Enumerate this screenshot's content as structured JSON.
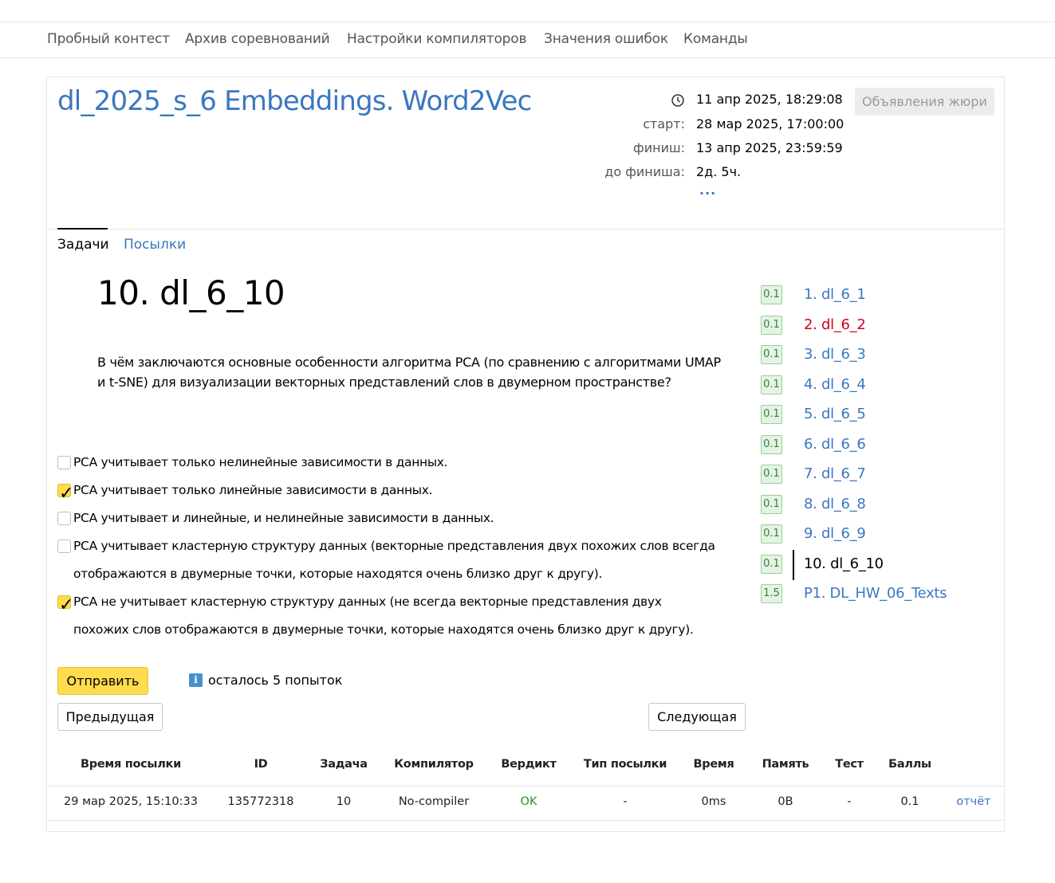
{
  "topnav": [
    "Пробный контест",
    "Архив соревнований",
    "Настройки компиляторов",
    "Значения ошибок",
    "Команды"
  ],
  "contest": {
    "title": "dl_2025_s_6 Embeddings. Word2Vec",
    "now": "11 апр 2025, 18:29:08",
    "start_label": "старт:",
    "start": "28 мар 2025, 17:00:00",
    "finish_label": "финиш:",
    "finish": "13 апр 2025, 23:59:59",
    "left_label": "до финиша:",
    "left": "2д. 5ч.",
    "more": "...",
    "jury_button": "Объявления жюри"
  },
  "tabs": [
    "Задачи",
    "Посылки"
  ],
  "problem": {
    "title": "10. dl_6_10",
    "statement": "В чём заключаются основные особенности алгоритма PCA (по сравнению с алгоритмами UMAP и t-SNE) для визуализации векторных представлений слов в двумерном пространстве?",
    "options": [
      {
        "text": "PCA учитывает только нелинейные зависимости в данных.",
        "checked": false
      },
      {
        "text": "PCA учитывает только линейные зависимости в данных.",
        "checked": true
      },
      {
        "text": "PCA учитывает и линейные, и нелинейные зависимости в данных.",
        "checked": false
      },
      {
        "text": "PCA учитывает кластерную структуру данных (векторные представления двух похожих слов всегда отображаются в двумерные точки, которые находятся очень близко друг к другу).",
        "checked": false
      },
      {
        "text": "PCA не учитывает кластерную структуру данных (не всегда векторные представления двух похожих слов отображаются в двумерные точки, которые находятся очень близко друг к другу).",
        "checked": true
      }
    ],
    "submit": "Отправить",
    "attempts": "осталось 5 попыток",
    "prev": "Предыдущая",
    "next": "Следующая"
  },
  "problem_list": [
    {
      "score": "0.1",
      "name": "1. dl_6_1",
      "state": "link"
    },
    {
      "score": "0.1",
      "name": "2. dl_6_2",
      "state": "error"
    },
    {
      "score": "0.1",
      "name": "3. dl_6_3",
      "state": "link"
    },
    {
      "score": "0.1",
      "name": "4. dl_6_4",
      "state": "link"
    },
    {
      "score": "0.1",
      "name": "5. dl_6_5",
      "state": "link"
    },
    {
      "score": "0.1",
      "name": "6. dl_6_6",
      "state": "link"
    },
    {
      "score": "0.1",
      "name": "7. dl_6_7",
      "state": "link"
    },
    {
      "score": "0.1",
      "name": "8. dl_6_8",
      "state": "link"
    },
    {
      "score": "0.1",
      "name": "9. dl_6_9",
      "state": "link"
    },
    {
      "score": "0.1",
      "name": "10. dl_6_10",
      "state": "current"
    },
    {
      "score": "1.5",
      "name": "P1. DL_HW_06_Texts",
      "state": "link"
    }
  ],
  "submissions": {
    "headers": [
      "Время посылки",
      "ID",
      "Задача",
      "Компилятор",
      "Вердикт",
      "Тип посылки",
      "Время",
      "Память",
      "Тест",
      "Баллы"
    ],
    "rows": [
      {
        "time": "29 мар 2025, 15:10:33",
        "id": "135772318",
        "task": "10",
        "compiler": "No-compiler",
        "verdict": "OK",
        "type": "-",
        "runtime": "0ms",
        "memory": "0B",
        "test": "-",
        "score": "0.1",
        "report": "отчёт"
      }
    ]
  },
  "colors": {
    "link": "#3a77c1",
    "error": "#d0021b",
    "ok": "#2e8b2e",
    "accent": "#ffdb4d"
  }
}
